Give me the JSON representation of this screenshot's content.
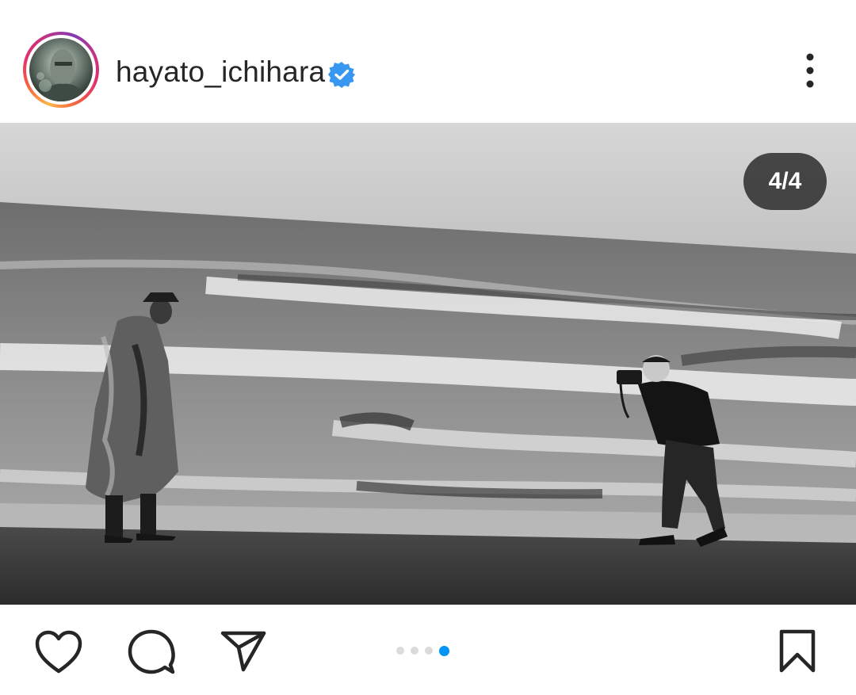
{
  "post": {
    "username": "hayato_ichihara",
    "verified": true,
    "carousel": {
      "counter": "4/4",
      "current": 4,
      "total": 4
    }
  },
  "colors": {
    "verified_badge": "#3897f0",
    "active_dot": "#0095f6",
    "inactive_dot": "#dbdbdb",
    "text": "#262626"
  },
  "icons": {
    "more": "more-vertical-icon",
    "like": "heart-icon",
    "comment": "comment-bubble-icon",
    "share": "paper-plane-icon",
    "save": "bookmark-icon",
    "verified": "verified-badge-icon"
  }
}
